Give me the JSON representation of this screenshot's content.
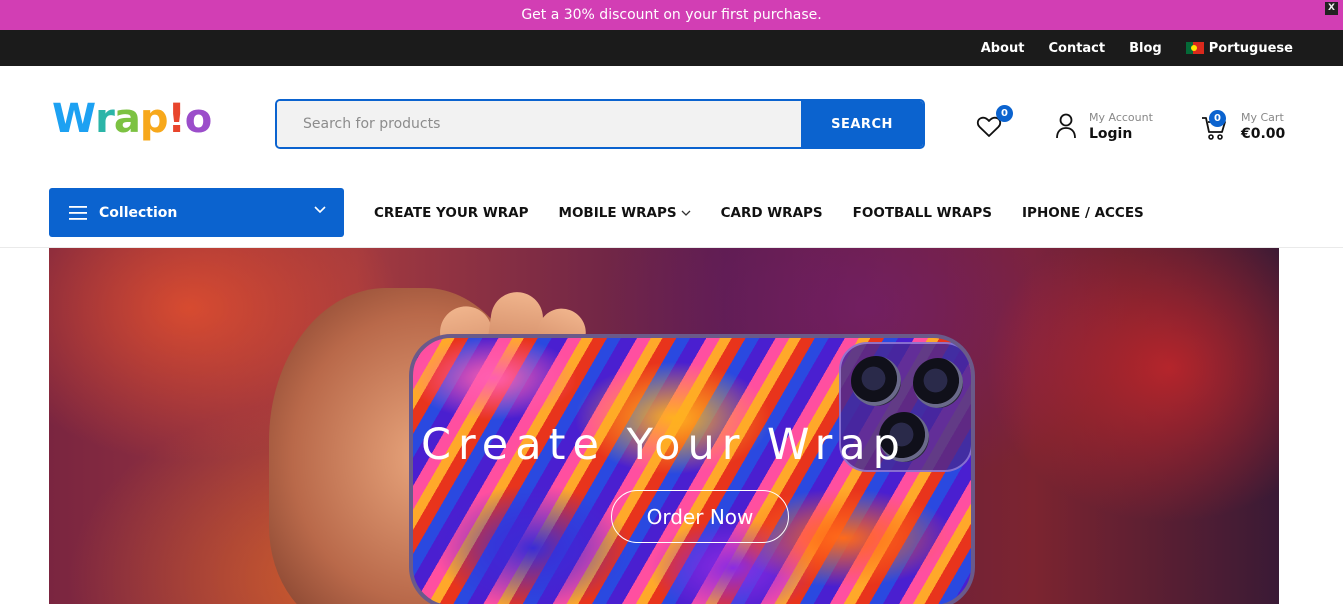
{
  "promo": {
    "text": "Get a 30% discount on your first purchase.",
    "close_label": "X"
  },
  "topbar": {
    "links": [
      {
        "label": "About"
      },
      {
        "label": "Contact"
      },
      {
        "label": "Blog"
      }
    ],
    "language": "Portuguese"
  },
  "header": {
    "logo": {
      "parts": [
        "W",
        "r",
        "a",
        "p",
        "!",
        "o"
      ]
    },
    "search": {
      "placeholder": "Search for products",
      "button": "SEARCH"
    },
    "wishlist": {
      "count": "0",
      "icon": "heart-icon"
    },
    "account": {
      "small": "My Account",
      "label": "Login",
      "icon": "user-icon"
    },
    "cart": {
      "small": "My Cart",
      "total": "€0.00",
      "count": "0",
      "icon": "cart-icon"
    }
  },
  "nav": {
    "collection": "Collection",
    "menu": [
      {
        "label": "CREATE YOUR WRAP"
      },
      {
        "label": "MOBILE WRAPS"
      },
      {
        "label": "CARD WRAPS"
      },
      {
        "label": "FOOTBALL WRAPS"
      },
      {
        "label": "IPHONE / ACCES"
      }
    ]
  },
  "hero": {
    "title": "Create Your Wrap",
    "button": "Order Now"
  },
  "colors": {
    "promo": "#d23eb4",
    "topbar": "#1b1b1b",
    "accent": "#0b63cf"
  }
}
